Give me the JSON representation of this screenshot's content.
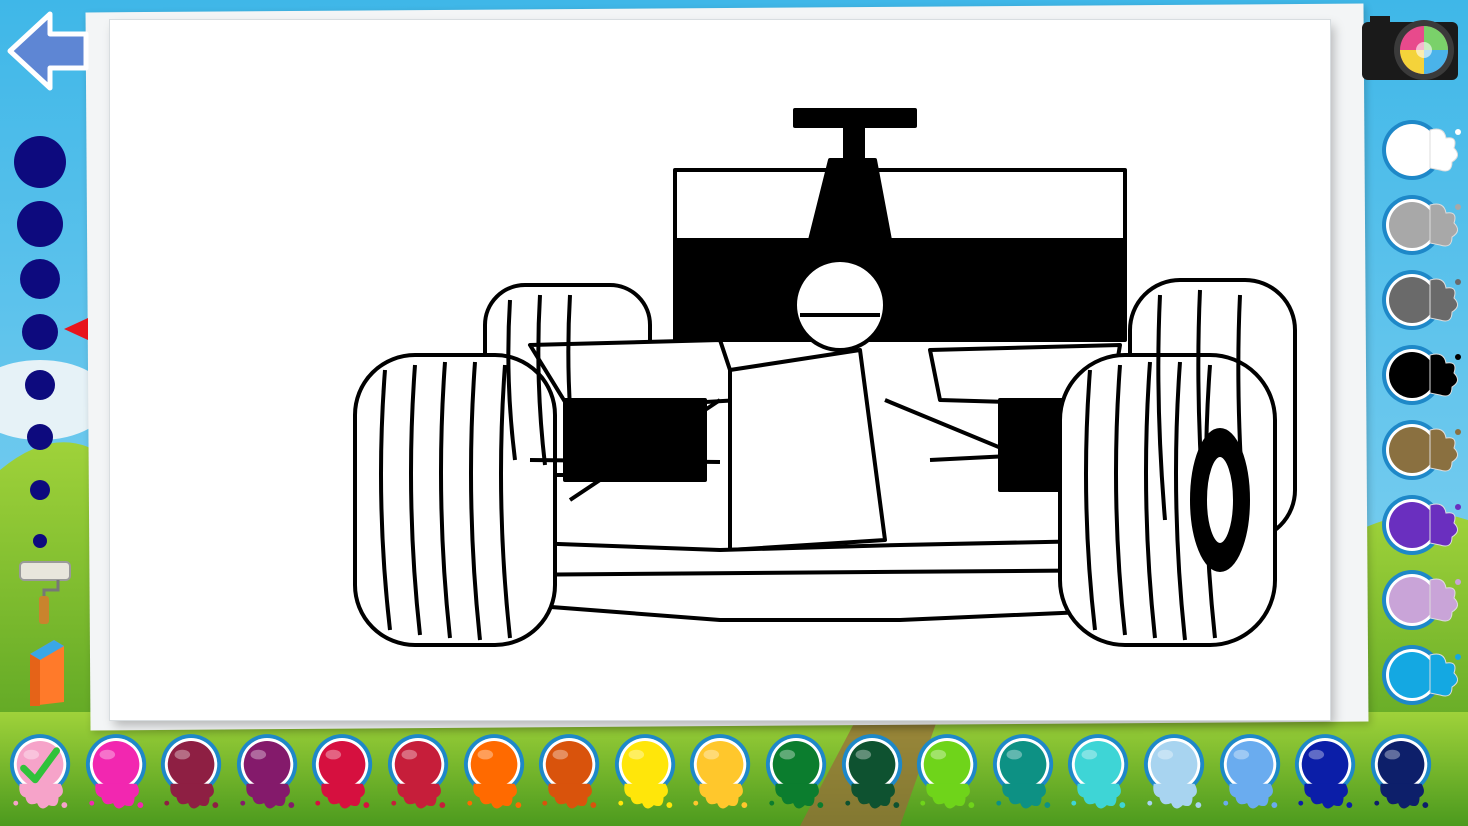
{
  "app": {
    "screen": "coloring-canvas",
    "drawing": "formula-one-race-car-outline"
  },
  "toolbar_left": {
    "back_icon": "back-arrow-icon",
    "brush_sizes": [
      {
        "name": "brush-size-1",
        "radius": 26
      },
      {
        "name": "brush-size-2",
        "radius": 23
      },
      {
        "name": "brush-size-3",
        "radius": 20
      },
      {
        "name": "brush-size-4",
        "radius": 18
      },
      {
        "name": "brush-size-5",
        "radius": 15
      },
      {
        "name": "brush-size-6",
        "radius": 13
      },
      {
        "name": "brush-size-7",
        "radius": 10
      },
      {
        "name": "brush-size-8",
        "radius": 7
      }
    ],
    "selected_brush_index": 3,
    "tools": [
      "paint-roller-icon",
      "eraser-icon"
    ]
  },
  "toolbar_right": {
    "camera_icon": "camera-icon",
    "gray_palette": [
      {
        "name": "white",
        "color": "#ffffff"
      },
      {
        "name": "light-gray",
        "color": "#a8a8a8"
      },
      {
        "name": "dark-gray",
        "color": "#6a6a6a"
      },
      {
        "name": "black",
        "color": "#000000"
      },
      {
        "name": "brown",
        "color": "#8a7040"
      },
      {
        "name": "purple",
        "color": "#6a2fbf"
      },
      {
        "name": "lavender",
        "color": "#c9a4d8"
      },
      {
        "name": "sky-blue",
        "color": "#14a8e2"
      }
    ]
  },
  "bottom_palette": {
    "selected_index": 0,
    "colors": [
      {
        "name": "light-pink",
        "color": "#f6a3c9"
      },
      {
        "name": "hot-pink",
        "color": "#f227b0"
      },
      {
        "name": "maroon",
        "color": "#8e1f43"
      },
      {
        "name": "plum",
        "color": "#841a6b"
      },
      {
        "name": "crimson",
        "color": "#d6103f"
      },
      {
        "name": "red",
        "color": "#c61e3a"
      },
      {
        "name": "orange",
        "color": "#ff6a00"
      },
      {
        "name": "burnt-orange",
        "color": "#d9530c"
      },
      {
        "name": "yellow",
        "color": "#ffe60a"
      },
      {
        "name": "gold",
        "color": "#ffc72c"
      },
      {
        "name": "green",
        "color": "#0b7d2e"
      },
      {
        "name": "dark-green",
        "color": "#0e5230"
      },
      {
        "name": "lime",
        "color": "#6fd41a"
      },
      {
        "name": "teal",
        "color": "#0d9184"
      },
      {
        "name": "turquoise",
        "color": "#3ed5d6"
      },
      {
        "name": "pale-blue",
        "color": "#a8d4f0"
      },
      {
        "name": "cornflower",
        "color": "#6aacef"
      },
      {
        "name": "royal-blue",
        "color": "#0b1ea8"
      },
      {
        "name": "navy",
        "color": "#0d1f6a"
      }
    ]
  }
}
